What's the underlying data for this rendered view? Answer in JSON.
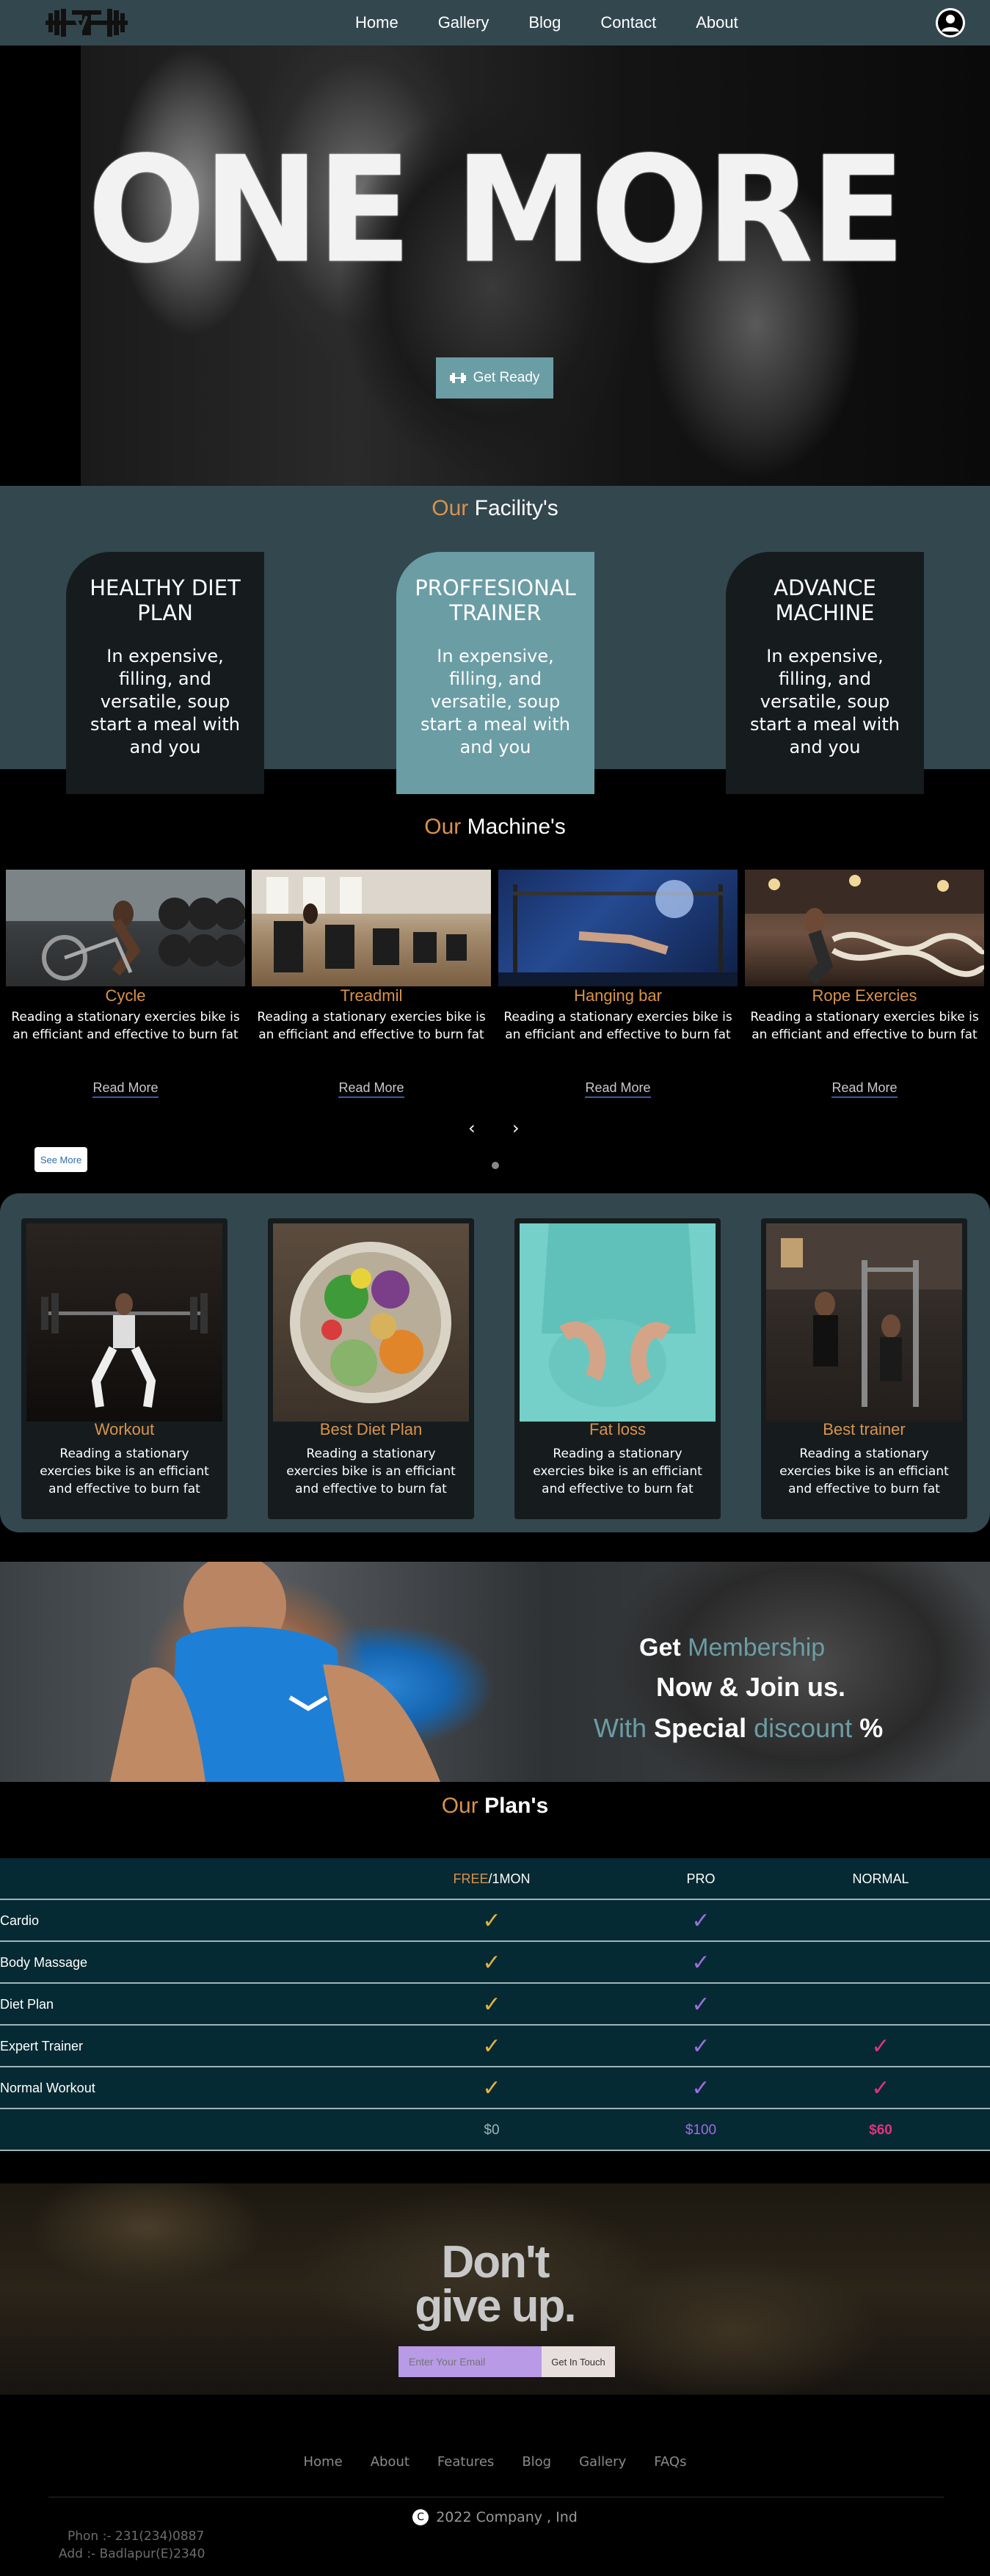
{
  "nav": {
    "links": [
      "Home",
      "Gallery",
      "Blog",
      "Contact",
      "About"
    ]
  },
  "hero": {
    "title": "ONE MORE",
    "button": "Get Ready",
    "button_icon": "dumbbell-icon"
  },
  "facility": {
    "title_prefix": "Our",
    "title": "Facility's",
    "cards": [
      {
        "title": "HEALTHY DIET PLAN",
        "text": "In expensive, filling, and versatile, soup start a meal with and you"
      },
      {
        "title": "PROFFESIONAL TRAINER",
        "text": "In expensive, filling, and versatile, soup start a meal with and you"
      },
      {
        "title": "ADVANCE MACHINE",
        "text": "In expensive, filling, and versatile, soup start a meal with and you"
      }
    ]
  },
  "machines": {
    "title_prefix": "Our",
    "title": "Machine's",
    "items": [
      {
        "name": "Cycle",
        "text": "Reading a stationary exercies bike is an efficiant and effective to burn fat",
        "link": "Read More"
      },
      {
        "name": "Treadmil",
        "text": "Reading a stationary exercies bike is an efficiant and effective to burn fat",
        "link": "Read More"
      },
      {
        "name": "Hanging bar",
        "text": "Reading a stationary exercies bike is an efficiant and effective to burn fat",
        "link": "Read More"
      },
      {
        "name": "Rope Exercies",
        "text": "Reading a stationary exercies bike is an efficiant and effective to burn fat",
        "link": "Read More"
      }
    ],
    "prev": "‹",
    "next": "›",
    "see_more": "See More"
  },
  "features": [
    {
      "title": "Workout",
      "text": "Reading a stationary exercies bike is an efficiant and effective to burn fat"
    },
    {
      "title": "Best Diet Plan",
      "text": "Reading a stationary exercies bike is an efficiant and effective to burn fat"
    },
    {
      "title": "Fat loss",
      "text": "Reading a stationary exercies bike is an efficiant and effective to burn fat"
    },
    {
      "title": "Best trainer",
      "text": "Reading a stationary exercies bike is an efficiant and effective to burn fat"
    }
  ],
  "membership": {
    "line1_a": "Get",
    "line1_b": "Membership",
    "line2": "Now & Join us.",
    "line3_a": "With",
    "line3_b": "Special",
    "line3_c": "discount",
    "line3_d": "%"
  },
  "plans": {
    "title_prefix": "Our",
    "title": "Plan's",
    "headers": {
      "free_a": "FREE",
      "free_b": "/1MON",
      "pro": "PRO",
      "normal": "NORMAL"
    },
    "rows": [
      {
        "label": "Cardio",
        "free": true,
        "pro": true,
        "normal": false
      },
      {
        "label": "Body Massage",
        "free": true,
        "pro": true,
        "normal": false
      },
      {
        "label": "Diet Plan",
        "free": true,
        "pro": true,
        "normal": false
      },
      {
        "label": "Expert Trainer",
        "free": true,
        "pro": true,
        "normal": true
      },
      {
        "label": "Normal Workout",
        "free": true,
        "pro": true,
        "normal": true
      }
    ],
    "check": "✓",
    "prices": {
      "free": "$0",
      "pro": "$100",
      "normal": "$60"
    },
    "colors": {
      "free": "#e3b341",
      "pro": "#9b6ee0",
      "normal": "#e0337e"
    }
  },
  "cta": {
    "line1": "Don't",
    "line2": "give up.",
    "email_placeholder": "Enter Your Email",
    "button": "Get In Touch"
  },
  "footer": {
    "links": [
      "Home",
      "About",
      "Features",
      "Blog",
      "Gallery",
      "FAQs"
    ],
    "copyright_symbol": "C",
    "copyright": "2022 Company , Ind",
    "phone": "Phon :- 231(234)0887",
    "address": "Add :- Badlapur(E)2340"
  }
}
